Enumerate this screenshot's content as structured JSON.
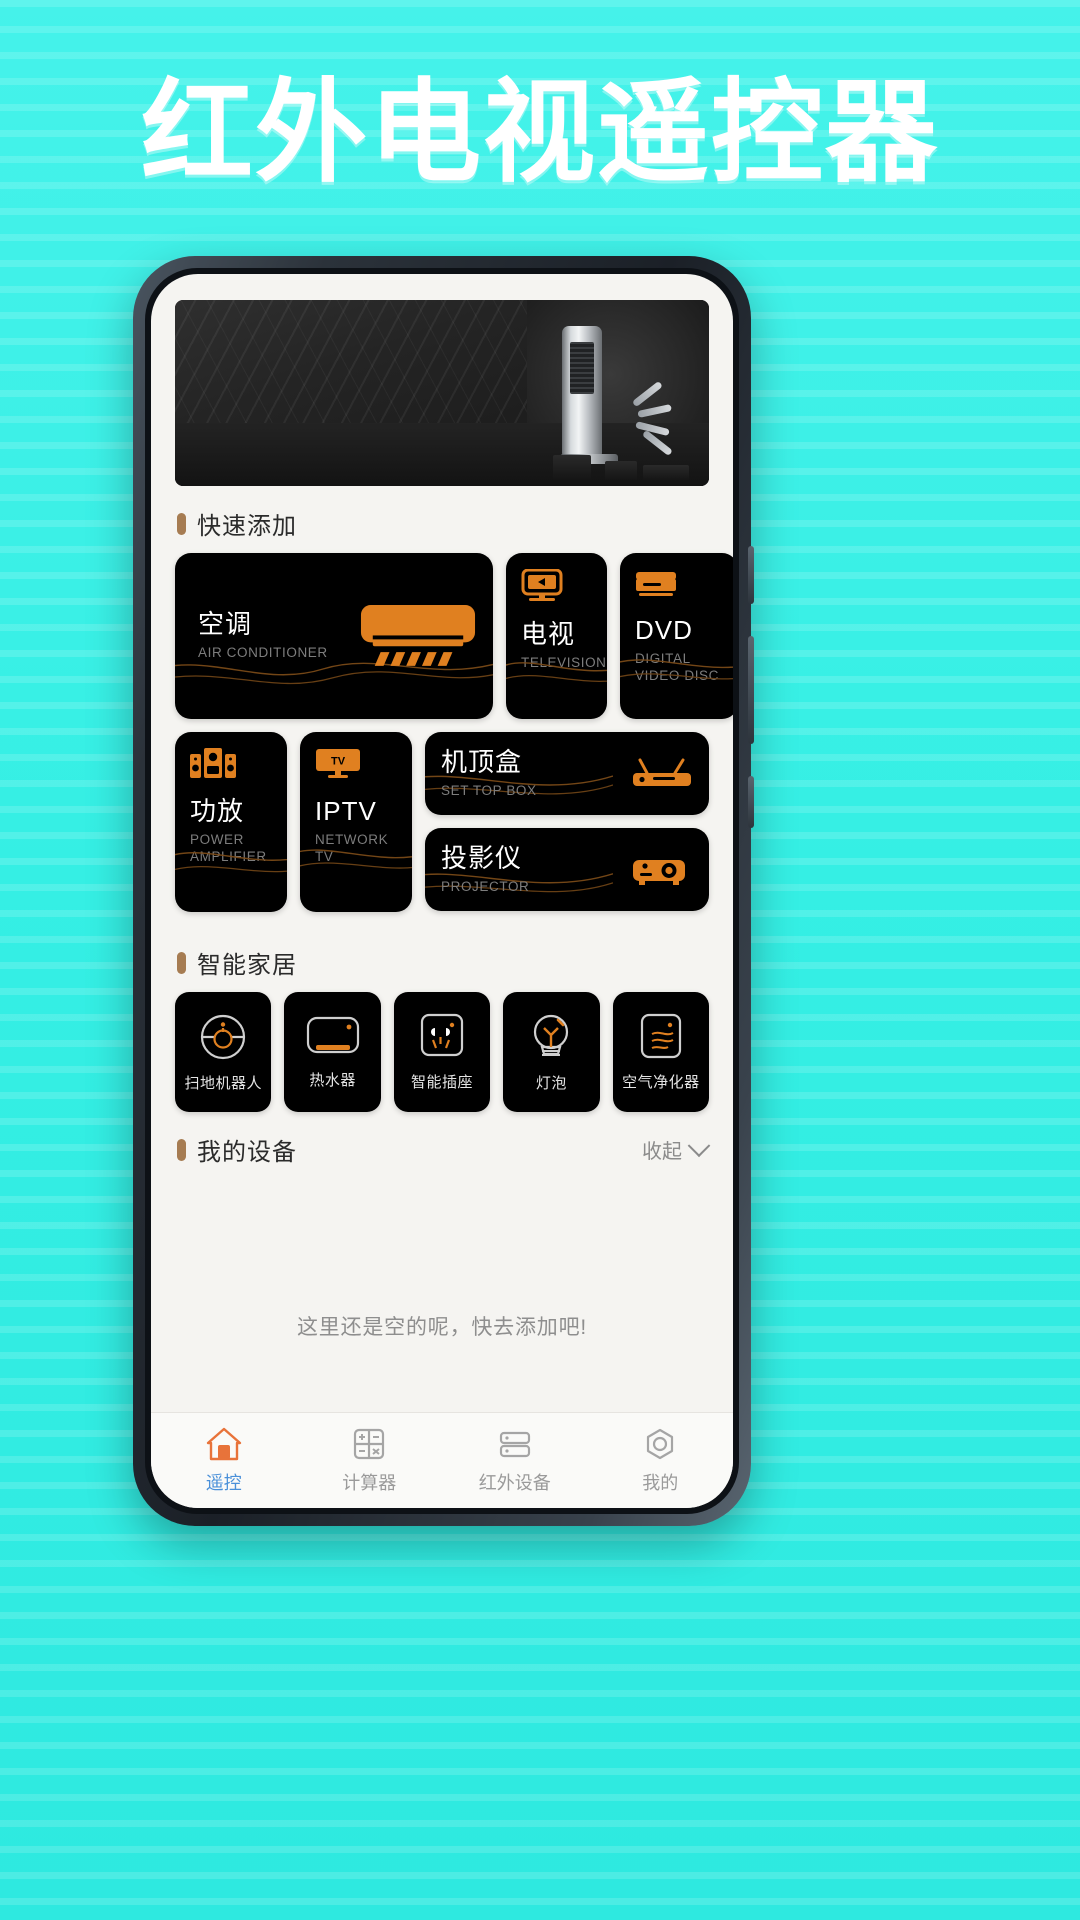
{
  "hero": {
    "title": "红外电视遥控器"
  },
  "colors": {
    "background": "#3cf0e6",
    "accent_orange": "#e08020",
    "section_marker": "#a67c52",
    "nav_active": "#4a90d9",
    "card_bg": "#000000",
    "screen_bg": "#f5f4f1"
  },
  "banner": {
    "name": "ac-product-banner"
  },
  "quick_add": {
    "title": "快速添加",
    "cards": [
      {
        "cn": "空调",
        "en": "AIR CONDITIONER",
        "icon": "air-conditioner-icon"
      },
      {
        "cn": "电视",
        "en": "TELEVISION",
        "icon": "television-icon"
      },
      {
        "cn": "DVD",
        "en": "DIGITAL VIDEO DISC",
        "icon": "dvd-player-icon"
      },
      {
        "cn": "功放",
        "en": "POWER AMPLIFIER",
        "icon": "speaker-amplifier-icon"
      },
      {
        "cn": "IPTV",
        "en": "NETWORK TV",
        "icon": "iptv-icon"
      },
      {
        "cn": "机顶盒",
        "en": "SET TOP BOX",
        "icon": "set-top-box-icon"
      },
      {
        "cn": "投影仪",
        "en": "PROJECTOR",
        "icon": "projector-icon"
      }
    ]
  },
  "smart_home": {
    "title": "智能家居",
    "items": [
      {
        "label": "扫地机器人",
        "icon": "robot-vacuum-icon"
      },
      {
        "label": "热水器",
        "icon": "water-heater-icon"
      },
      {
        "label": "智能插座",
        "icon": "smart-socket-icon"
      },
      {
        "label": "灯泡",
        "icon": "light-bulb-icon"
      },
      {
        "label": "空气净化器",
        "icon": "air-purifier-icon"
      }
    ]
  },
  "my_devices": {
    "title": "我的设备",
    "collapse_label": "收起",
    "empty_text": "这里还是空的呢，快去添加吧!"
  },
  "bottom_nav": {
    "items": [
      {
        "label": "遥控",
        "icon": "home-remote-icon",
        "active": true
      },
      {
        "label": "计算器",
        "icon": "calculator-icon",
        "active": false
      },
      {
        "label": "红外设备",
        "icon": "ir-device-icon",
        "active": false
      },
      {
        "label": "我的",
        "icon": "profile-icon",
        "active": false
      }
    ]
  }
}
